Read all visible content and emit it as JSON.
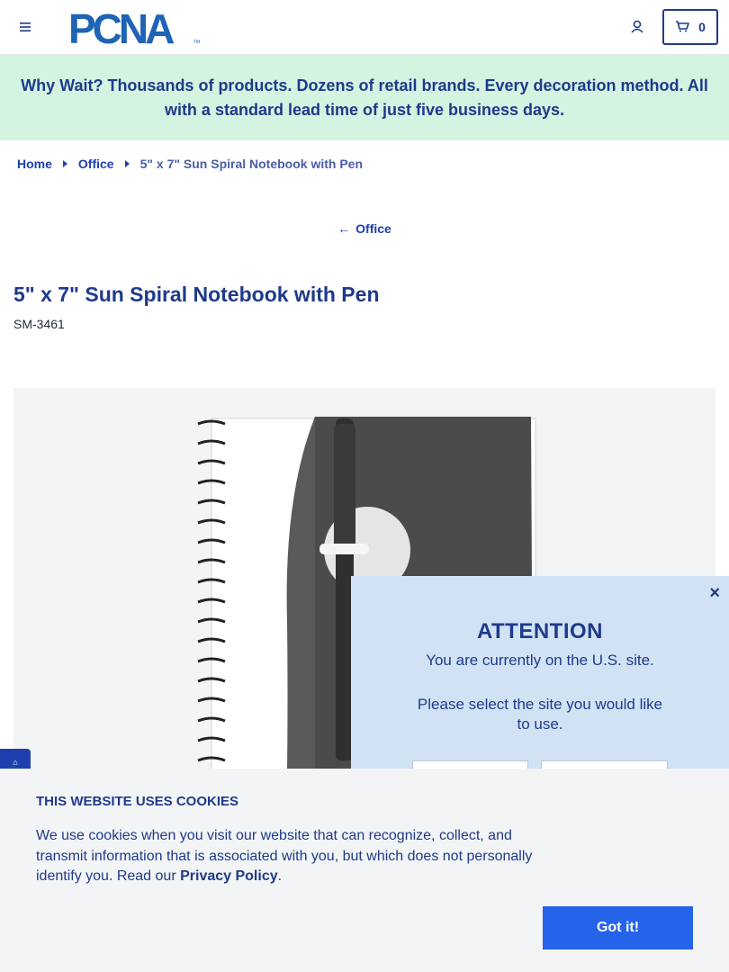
{
  "header": {
    "menu_icon": "hamburger-menu-icon",
    "logo_text": "PCNA",
    "logo_tm": "TM",
    "account_icon": "user-icon",
    "cart_icon": "cart-icon",
    "cart_count": "0"
  },
  "promo": {
    "text": "Why Wait? Thousands of products. Dozens of retail brands. Every decoration method. All with a standard lead time of just five business days."
  },
  "breadcrumb": {
    "home": "Home",
    "category": "Office",
    "current": "5\" x 7\" Sun Spiral Notebook with Pen"
  },
  "back_link": {
    "label": "Office"
  },
  "product": {
    "title": "5\" x 7\" Sun Spiral Notebook with Pen",
    "sku": "SM-3461"
  },
  "modal": {
    "close": "×",
    "title": "ATTENTION",
    "line1": "You are currently on the U.S. site.",
    "line2": "Please select the site you would like to use."
  },
  "cookie": {
    "title": "THIS WEBSITE USES COOKIES",
    "text_before": "We use cookies when you visit our website that can recognize, collect, and transmit information that is associated with you, but which does not personally identify you. Read our ",
    "link": "Privacy Policy",
    "text_after": ".",
    "button": "Got it!"
  },
  "colors": {
    "brand_navy": "#1e3a8a",
    "promo_bg": "#d4f3e1",
    "modal_bg": "#d2e2f5",
    "button_blue": "#2563eb"
  }
}
